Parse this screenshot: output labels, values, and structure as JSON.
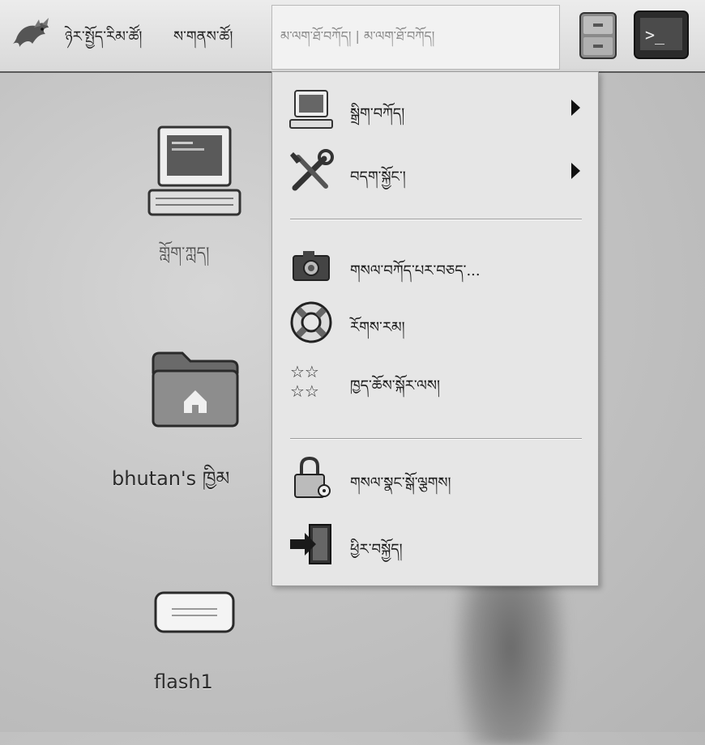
{
  "panel": {
    "applications_label": "ཉེར་སྤྱོད་རིམ་ཚོ།",
    "places_label": "ས་གནས་ཚོ།",
    "system_menu_label": "མ་ལག་ཐོ་བཀོད། | མ་ལག་ཐོ་བཀོད།",
    "launchers": [
      "file-cabinet-icon",
      "terminal-icon"
    ]
  },
  "menu": {
    "items": [
      {
        "label": "སྒྲིག་བཀོད།",
        "icon": "computer-icon",
        "submenu": true
      },
      {
        "label": "བདག་སྐྱོང་།",
        "icon": "tools-icon",
        "submenu": true
      },
      {
        "label": "གསལ་བཀོད་པར་བཅད་...",
        "icon": "camera-icon",
        "submenu": false
      },
      {
        "label": "རོགས་རམ།",
        "icon": "lifebuoy-icon",
        "submenu": false
      },
      {
        "label": "ཁྱད་ཆོས་སྐོར་ལས།",
        "icon": "about-stars-icon",
        "submenu": false
      },
      {
        "label": "གསལ་སྣང་སྒོ་ལྕགས།",
        "icon": "lock-screen-icon",
        "submenu": false
      },
      {
        "label": "ཕྱིར་བསྐྱོད།",
        "icon": "logout-icon",
        "submenu": false
      }
    ]
  },
  "desktop": {
    "icons": [
      {
        "name": "computer",
        "label": "གློག་ཀླད།",
        "icon": "computer-icon"
      },
      {
        "name": "home",
        "label": "bhutan's ཁྱིམ",
        "icon": "home-folder-icon"
      },
      {
        "name": "flash",
        "label": "flash1",
        "icon": "drive-icon"
      }
    ]
  },
  "colors": {
    "panel_bg": "#e4e4e4",
    "menu_bg": "#e6e6e6",
    "desktop_bg": "#c4c4c4"
  }
}
